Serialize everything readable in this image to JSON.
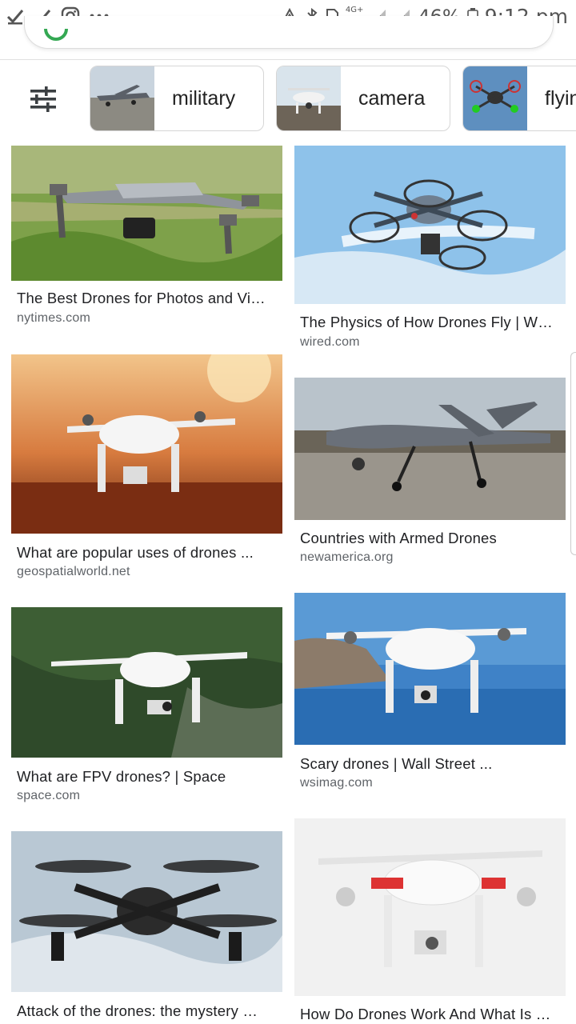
{
  "status_bar": {
    "left_icons": [
      "check-icon",
      "check-icon",
      "instagram-icon",
      "more-dots-icon"
    ],
    "right_icons": [
      "recycle-icon",
      "bluetooth-icon",
      "sim-icon",
      "signal-4g-icon",
      "signal-icon",
      "battery-icon"
    ],
    "network_label": "4G+",
    "battery": "46%",
    "time": "9:12 pm"
  },
  "chips": [
    {
      "label": "military",
      "thumb": "military-drone-thumbnail"
    },
    {
      "label": "camera",
      "thumb": "camera-drone-thumbnail"
    },
    {
      "label": "flyin",
      "thumb": "flying-drone-thumbnail"
    }
  ],
  "results": [
    {
      "title": "The Best Drones for Photos and Vi…",
      "source": "nytimes.com"
    },
    {
      "title": "The Physics of How Drones Fly | W…",
      "source": "wired.com"
    },
    {
      "title": "What are popular uses of drones ...",
      "source": "geospatialworld.net"
    },
    {
      "title": "Countries with Armed Drones",
      "source": "newamerica.org"
    },
    {
      "title": "What are FPV drones? | Space",
      "source": "space.com"
    },
    {
      "title": "Scary drones | Wall Street ...",
      "source": "wsimag.com"
    },
    {
      "title": "Attack of the drones: the mystery …",
      "source": ""
    },
    {
      "title": "How Do Drones Work And What Is …",
      "source": ""
    }
  ],
  "colors": {
    "accent_text": "#202124",
    "source_text": "#5f6368",
    "chip_border": "#d6d6d6"
  }
}
